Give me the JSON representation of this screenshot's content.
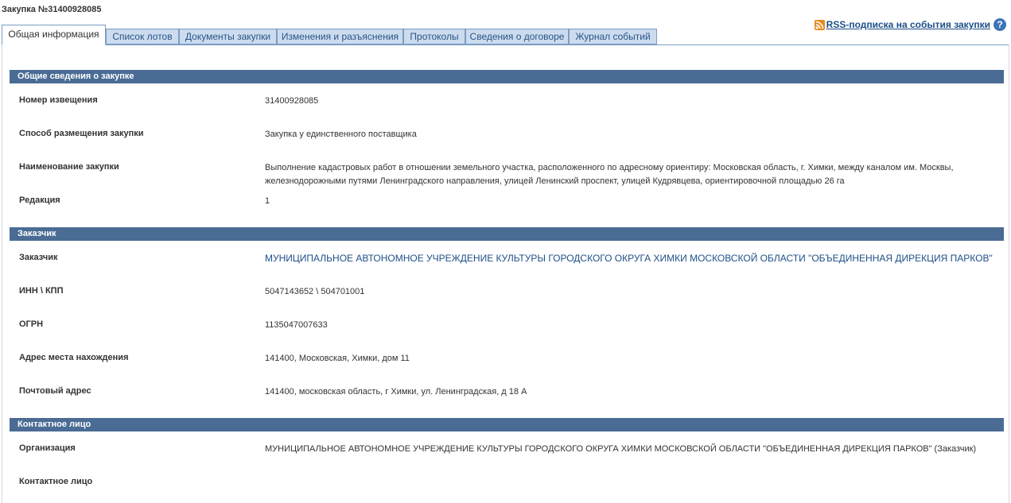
{
  "page": {
    "title": "Закупка №31400928085"
  },
  "tabs": [
    {
      "label": "Общая информация",
      "active": true
    },
    {
      "label": "Список лотов"
    },
    {
      "label": "Документы закупки"
    },
    {
      "label": "Изменения и разъяснения"
    },
    {
      "label": "Протоколы"
    },
    {
      "label": "Сведения о договоре"
    },
    {
      "label": "Журнал событий"
    }
  ],
  "rss": {
    "label": "RSS-подписка на события закупки",
    "icon": "rss-icon",
    "help": "?"
  },
  "sections": {
    "general": {
      "header": "Общие сведения о закупке",
      "rows": [
        {
          "label": "Номер извещения",
          "value": "31400928085"
        },
        {
          "label": "Способ размещения закупки",
          "value": "Закупка у единственного поставщика"
        },
        {
          "label": "Наименование закупки",
          "value": "Выполнение кадастровых работ в отношении земельного участка, расположенного по адресному ориентиру: Московская область, г. Химки, между каналом им. Москвы, железнодорожными путями Ленинградского направления, улицей Ленинский проспект, улицей Кудрявцева, ориентировочной площадью 26 га"
        },
        {
          "label": "Редакция",
          "value": "1"
        }
      ]
    },
    "customer": {
      "header": "Заказчик",
      "rows": [
        {
          "label": "Заказчик",
          "value": "МУНИЦИПАЛЬНОЕ АВТОНОМНОЕ УЧРЕЖДЕНИЕ КУЛЬТУРЫ ГОРОДСКОГО ОКРУГА ХИМКИ МОСКОВСКОЙ ОБЛАСТИ \"ОБЪЕДИНЕННАЯ ДИРЕКЦИЯ ПАРКОВ\""
        },
        {
          "label": "ИНН \\ КПП",
          "value": "5047143652 \\ 504701001"
        },
        {
          "label": "ОГРН",
          "value": "1135047007633"
        },
        {
          "label": "Адрес места нахождения",
          "value": "141400, Московская, Химки, дом 11"
        },
        {
          "label": "Почтовый адрес",
          "value": "141400, московская область, г Химки, ул. Ленинградская, д 18 А"
        }
      ]
    },
    "contact": {
      "header": "Контактное лицо",
      "rows": [
        {
          "label": "Организация",
          "value": "МУНИЦИПАЛЬНОЕ АВТОНОМНОЕ УЧРЕЖДЕНИЕ КУЛЬТУРЫ ГОРОДСКОГО ОКРУГА ХИМКИ МОСКОВСКОЙ ОБЛАСТИ \"ОБЪЕДИНЕННАЯ ДИРЕКЦИЯ ПАРКОВ\" (Заказчик)"
        },
        {
          "label": "Контактное лицо",
          "value": ""
        }
      ]
    }
  },
  "colors": {
    "section_bg": "#4a6c94",
    "tab_bg": "#ccdcee",
    "link": "#1e4f88",
    "rss": "#e8891c"
  }
}
